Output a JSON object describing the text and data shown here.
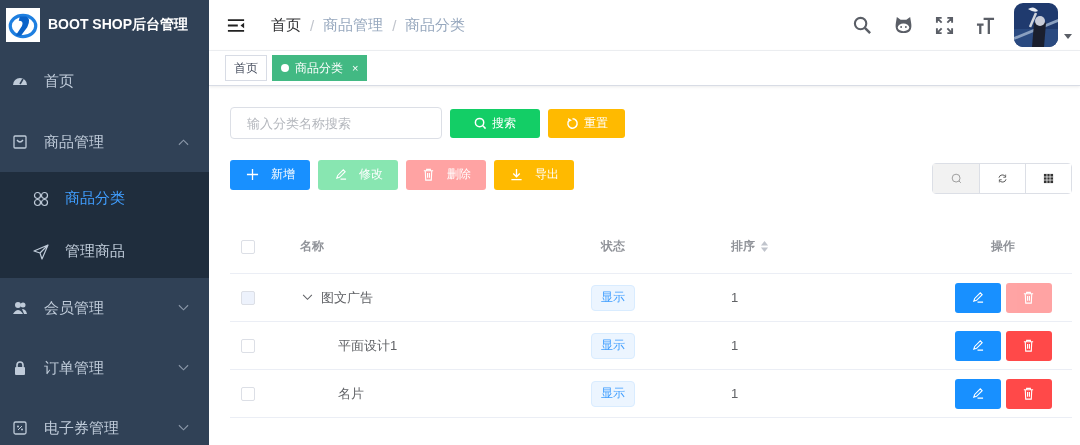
{
  "sidebar": {
    "logo_text": "BOOT SHOP后台管理",
    "menu": [
      {
        "label": "首页",
        "selected": false
      },
      {
        "label": "商品管理",
        "selected": false,
        "expanded": true,
        "children": [
          {
            "label": "商品分类",
            "selected": true
          },
          {
            "label": "管理商品",
            "selected": false
          }
        ]
      },
      {
        "label": "会员管理",
        "selected": false,
        "expanded": false
      },
      {
        "label": "订单管理",
        "selected": false,
        "expanded": false
      },
      {
        "label": "电子券管理",
        "selected": false,
        "expanded": false
      }
    ]
  },
  "header": {
    "separator": "/",
    "breadcrumb": [
      {
        "label": "首页",
        "link": true
      },
      {
        "label": "商品管理",
        "link": false
      },
      {
        "label": "商品分类",
        "link": false
      }
    ]
  },
  "tags": [
    {
      "label": "首页",
      "selected": false
    },
    {
      "label": "商品分类",
      "selected": true,
      "close": "×"
    }
  ],
  "search": {
    "placeholder": "输入分类名称搜索",
    "buttons": [
      {
        "label": "搜索",
        "kind": "search"
      },
      {
        "label": "重置",
        "kind": "reset"
      }
    ]
  },
  "actions": [
    {
      "label": "新增",
      "kind": "add",
      "disabled": false
    },
    {
      "label": "修改",
      "kind": "edit",
      "disabled": true
    },
    {
      "label": "删除",
      "kind": "delete",
      "disabled": true
    },
    {
      "label": "导出",
      "kind": "export",
      "disabled": false
    }
  ],
  "toolbar": [
    {
      "kind": "search",
      "selected": true
    },
    {
      "kind": "refresh",
      "selected": false
    },
    {
      "kind": "columns",
      "selected": false
    }
  ],
  "table": {
    "header_checked": false,
    "columns": [
      {
        "label": "名称",
        "sortable": false
      },
      {
        "label": "状态",
        "sortable": false
      },
      {
        "label": "排序",
        "sortable": true
      },
      {
        "label": "操作",
        "sortable": false
      }
    ],
    "rows": [
      {
        "name": "图文广告",
        "status": "显示",
        "sort": "1",
        "checked": false,
        "checkbox_disabled": true,
        "delete_disabled": true,
        "expanded": true,
        "children": [
          {
            "name": "平面设计1",
            "status": "显示",
            "sort": "1",
            "checked": false,
            "checkbox_disabled": false,
            "delete_disabled": false
          },
          {
            "name": "名片",
            "status": "显示",
            "sort": "1",
            "checked": false,
            "checkbox_disabled": false,
            "delete_disabled": false
          }
        ]
      }
    ]
  }
}
